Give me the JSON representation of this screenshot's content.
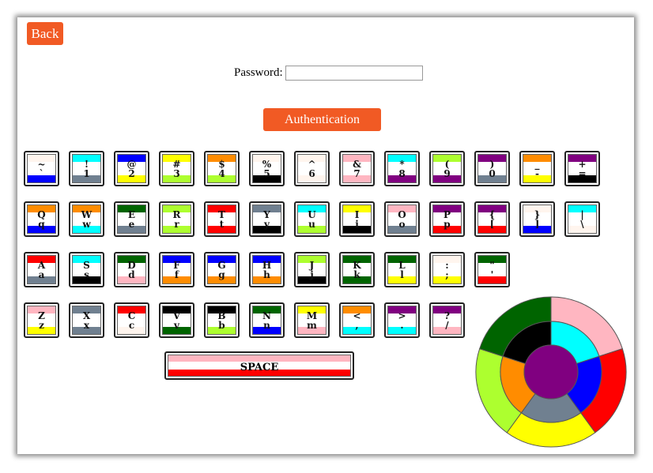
{
  "header": {
    "back_label": "Back"
  },
  "password": {
    "label": "Password:",
    "value": ""
  },
  "auth": {
    "label": "Authentication"
  },
  "colors": {
    "blue": "#0000ff",
    "gray": "#708090",
    "yellow": "#ffff00",
    "lime": "#adff2f",
    "orange": "#ff8c00",
    "black": "#000000",
    "seashell": "#fff5ee",
    "pink": "#ffb6c1",
    "purple": "#800080",
    "aqua": "#00ffff",
    "darkgreen": "#006400",
    "red": "#ff0000",
    "white": "#ffffff"
  },
  "keys": [
    [
      {
        "up": "~",
        "low": "`",
        "top": "seashell",
        "bot": "blue"
      },
      {
        "up": "!",
        "low": "1",
        "top": "aqua",
        "bot": "gray"
      },
      {
        "up": "@",
        "low": "2",
        "top": "blue",
        "bot": "yellow"
      },
      {
        "up": "#",
        "low": "3",
        "top": "yellow",
        "bot": "lime"
      },
      {
        "up": "$",
        "low": "4",
        "top": "orange",
        "bot": "lime"
      },
      {
        "up": "%",
        "low": "5",
        "top": "seashell",
        "bot": "black"
      },
      {
        "up": "^",
        "low": "6",
        "top": "seashell",
        "bot": "seashell"
      },
      {
        "up": "&",
        "low": "7",
        "top": "pink",
        "bot": "pink"
      },
      {
        "up": "*",
        "low": "8",
        "top": "aqua",
        "bot": "purple"
      },
      {
        "up": "(",
        "low": "9",
        "top": "lime",
        "bot": "purple"
      },
      {
        "up": ")",
        "low": "0",
        "top": "purple",
        "bot": "gray"
      },
      {
        "up": "_",
        "low": "-",
        "top": "orange",
        "bot": "yellow"
      },
      {
        "up": "+",
        "low": "=",
        "top": "purple",
        "bot": "black"
      }
    ],
    [
      {
        "up": "Q",
        "low": "q",
        "top": "orange",
        "bot": "blue"
      },
      {
        "up": "W",
        "low": "w",
        "top": "orange",
        "bot": "aqua"
      },
      {
        "up": "E",
        "low": "e",
        "top": "darkgreen",
        "bot": "gray"
      },
      {
        "up": "R",
        "low": "r",
        "top": "lime",
        "bot": "lime"
      },
      {
        "up": "T",
        "low": "t",
        "top": "red",
        "bot": "red"
      },
      {
        "up": "Y",
        "low": "y",
        "top": "gray",
        "bot": "black"
      },
      {
        "up": "U",
        "low": "u",
        "top": "aqua",
        "bot": "lime"
      },
      {
        "up": "I",
        "low": "i",
        "top": "yellow",
        "bot": "black"
      },
      {
        "up": "O",
        "low": "o",
        "top": "pink",
        "bot": "gray"
      },
      {
        "up": "P",
        "low": "p",
        "top": "purple",
        "bot": "red"
      },
      {
        "up": "{",
        "low": "[",
        "top": "purple",
        "bot": "red"
      },
      {
        "up": "}",
        "low": "]",
        "top": "seashell",
        "bot": "blue"
      },
      {
        "up": "|",
        "low": "\\",
        "top": "aqua",
        "bot": "seashell"
      }
    ],
    [
      {
        "up": "A",
        "low": "a",
        "top": "red",
        "bot": "gray"
      },
      {
        "up": "S",
        "low": "s",
        "top": "aqua",
        "bot": "black"
      },
      {
        "up": "D",
        "low": "d",
        "top": "darkgreen",
        "bot": "pink"
      },
      {
        "up": "F",
        "low": "f",
        "top": "blue",
        "bot": "orange"
      },
      {
        "up": "G",
        "low": "g",
        "top": "blue",
        "bot": "orange"
      },
      {
        "up": "H",
        "low": "h",
        "top": "blue",
        "bot": "orange"
      },
      {
        "up": "J",
        "low": "j",
        "top": "lime",
        "bot": "black"
      },
      {
        "up": "K",
        "low": "k",
        "top": "darkgreen",
        "bot": "darkgreen"
      },
      {
        "up": "L",
        "low": "l",
        "top": "darkgreen",
        "bot": "yellow"
      },
      {
        "up": ":",
        "low": ";",
        "top": "seashell",
        "bot": "yellow"
      },
      {
        "up": "\"",
        "low": "'",
        "top": "darkgreen",
        "bot": "red"
      }
    ],
    [
      {
        "up": "Z",
        "low": "z",
        "top": "pink",
        "bot": "yellow"
      },
      {
        "up": "X",
        "low": "x",
        "top": "gray",
        "bot": "gray"
      },
      {
        "up": "C",
        "low": "c",
        "top": "red",
        "bot": "seashell"
      },
      {
        "up": "V",
        "low": "v",
        "top": "black",
        "bot": "darkgreen"
      },
      {
        "up": "B",
        "low": "b",
        "top": "black",
        "bot": "lime"
      },
      {
        "up": "N",
        "low": "n",
        "top": "darkgreen",
        "bot": "blue"
      },
      {
        "up": "M",
        "low": "m",
        "top": "yellow",
        "bot": "pink"
      },
      {
        "up": "<",
        "low": ",",
        "top": "orange",
        "bot": "aqua"
      },
      {
        "up": ">",
        "low": ".",
        "top": "purple",
        "bot": "aqua"
      },
      {
        "up": "?",
        "low": "/",
        "top": "purple",
        "bot": "pink"
      }
    ]
  ],
  "space": {
    "label": "SPACE",
    "top": "pink",
    "bot": "red"
  },
  "wheel": {
    "outer": [
      "pink",
      "red",
      "yellow",
      "lime",
      "darkgreen"
    ],
    "inner": [
      "aqua",
      "blue",
      "gray",
      "orange",
      "black"
    ],
    "center": "purple"
  }
}
